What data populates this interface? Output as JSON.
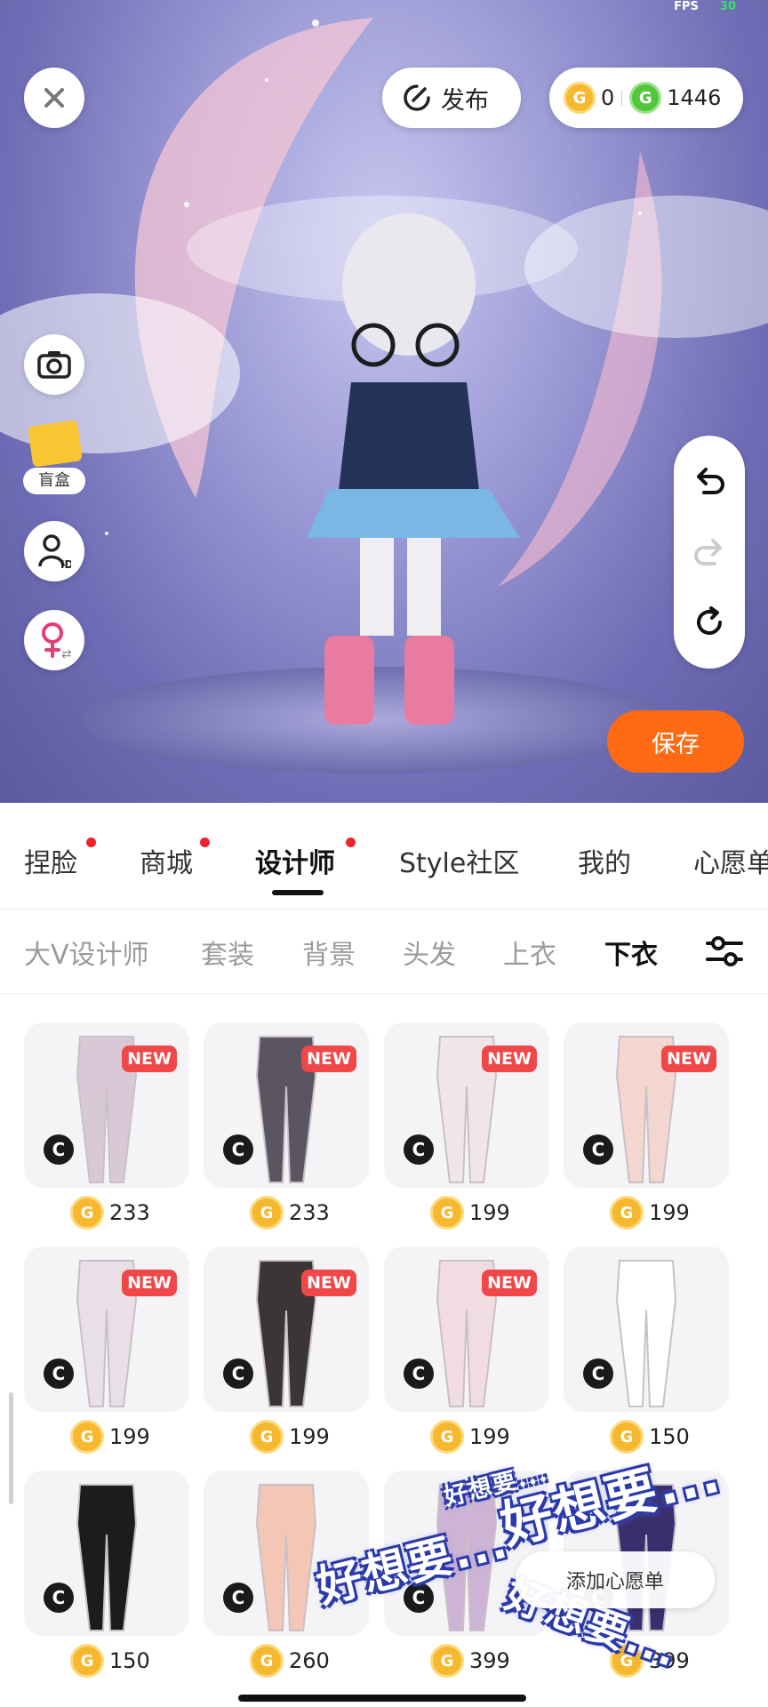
{
  "status": {
    "fps_label": "FPS",
    "fps_value": "30"
  },
  "scene": {
    "publish_label": "发布",
    "coin_balance": "0",
    "gem_balance": "1446",
    "blind_box_label": "盲盒",
    "save_label": "保存"
  },
  "main_tabs": [
    {
      "label": "捏脸",
      "dot": true
    },
    {
      "label": "商城",
      "dot": true
    },
    {
      "label": "设计师",
      "dot": true,
      "active": true
    },
    {
      "label": "Style社区",
      "dot": false
    },
    {
      "label": "我的",
      "dot": false
    },
    {
      "label": "心愿单",
      "dot": false
    }
  ],
  "sub_tabs": [
    {
      "label": "大V设计师"
    },
    {
      "label": "套装"
    },
    {
      "label": "背景"
    },
    {
      "label": "头发"
    },
    {
      "label": "上衣"
    },
    {
      "label": "下衣",
      "active": true
    }
  ],
  "items": [
    {
      "price": "233",
      "new": "NEW",
      "creator": "C"
    },
    {
      "price": "233",
      "new": "NEW",
      "creator": "C"
    },
    {
      "price": "199",
      "new": "NEW",
      "creator": "C"
    },
    {
      "price": "199",
      "new": "NEW",
      "creator": "C"
    },
    {
      "price": "199",
      "new": "NEW",
      "creator": "C"
    },
    {
      "price": "199",
      "new": "NEW",
      "creator": "C"
    },
    {
      "price": "199",
      "new": "NEW",
      "creator": "C"
    },
    {
      "price": "150",
      "new": "",
      "creator": "C"
    },
    {
      "price": "150",
      "new": "",
      "creator": "C"
    },
    {
      "price": "260",
      "new": "",
      "creator": "C"
    },
    {
      "price": "399",
      "new": "",
      "creator": "C"
    },
    {
      "price": "399",
      "new": "",
      "creator": "C"
    }
  ],
  "wishlist_add_label": "添加心愿单",
  "stickers": [
    "好想要...",
    "好想要...",
    "好想要...",
    "好想要..."
  ],
  "colors": {
    "accent": "#ff6a12",
    "dot": "#f0232c",
    "new_badge": "#f04848",
    "coin": "#f5b82e",
    "gem": "#54c63d"
  }
}
